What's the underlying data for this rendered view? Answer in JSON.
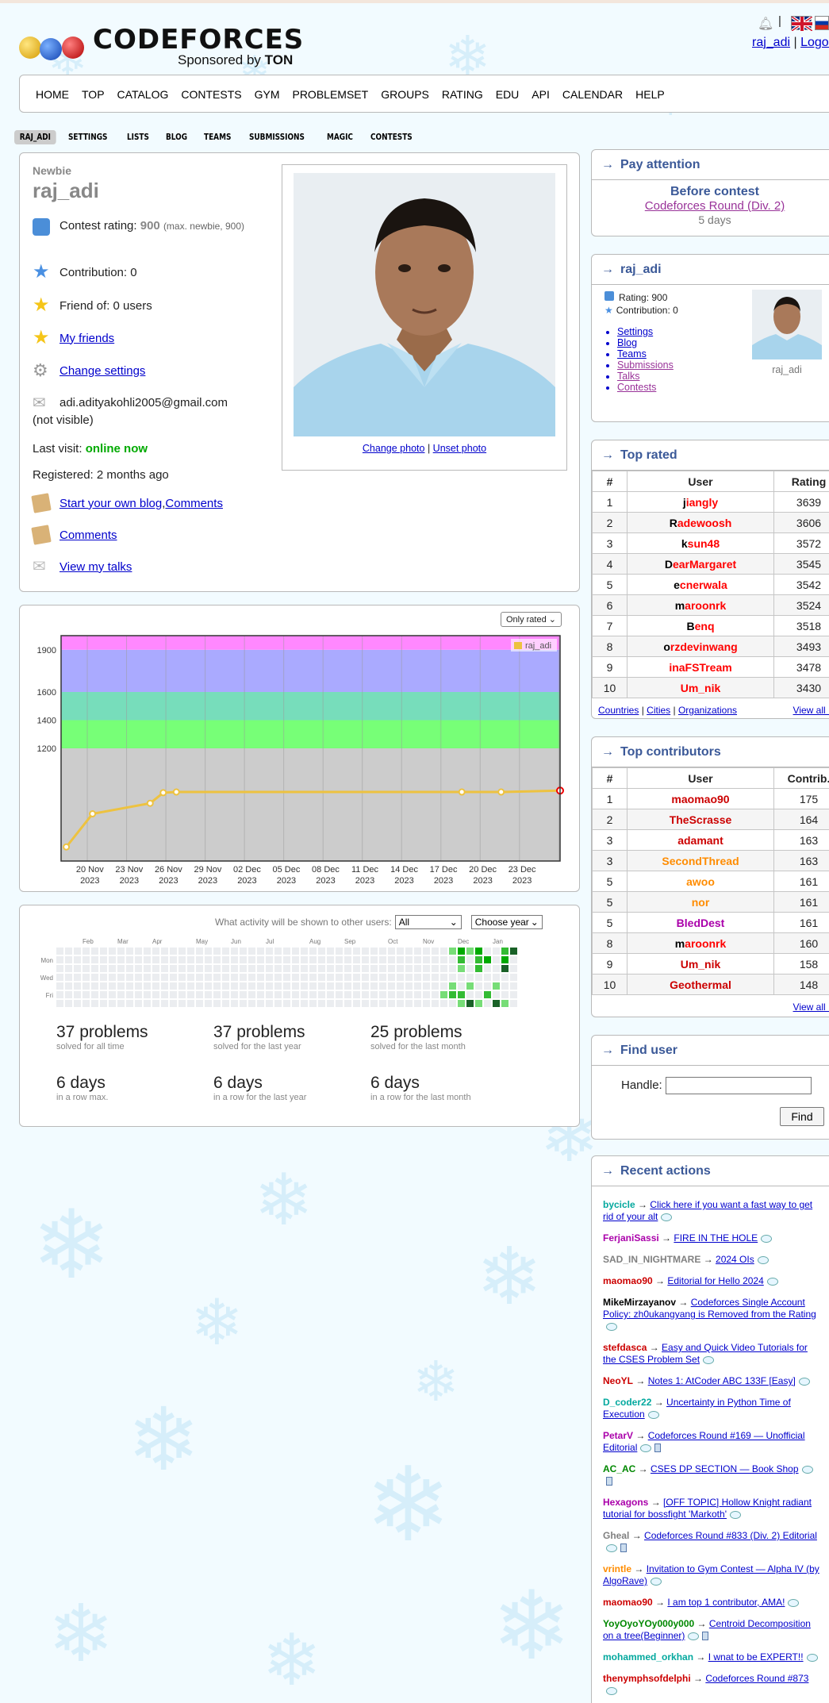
{
  "header": {
    "logo_text": "CODEFORCES",
    "sponsor_prefix": "Sponsored by",
    "sponsor_name": "TON",
    "user_link": "raj_adi",
    "separator": "|",
    "logout": "Logout"
  },
  "main_menu": [
    "HOME",
    "TOP",
    "CATALOG",
    "CONTESTS",
    "GYM",
    "PROBLEMSET",
    "GROUPS",
    "RATING",
    "EDU",
    "API",
    "CALENDAR",
    "HELP"
  ],
  "sub_menu": [
    "RAJ_ADI",
    "SETTINGS",
    "LISTS",
    "BLOG",
    "TEAMS",
    "SUBMISSIONS",
    "MAGIC",
    "CONTESTS"
  ],
  "profile": {
    "rank": "Newbie",
    "handle": "raj_adi",
    "rating_label": "Contest rating:",
    "rating": "900",
    "rating_max": "(max. newbie, 900)",
    "contribution": "Contribution: 0",
    "friend_of": "Friend of: 0 users",
    "my_friends": "My friends",
    "change_settings": "Change settings",
    "email": "adi.adityakohli2005@gmail.com",
    "email_note": "(not visible)",
    "last_visit_label": "Last visit:",
    "last_visit": "online now",
    "registered": "Registered: 2 months ago",
    "blog_link": "Start your own blog",
    "comments_inline": "Comments",
    "comments": "Comments",
    "talks": "View my talks",
    "change_photo": "Change photo",
    "unset_photo": "Unset photo",
    "photo_sep": "|"
  },
  "chart_data": {
    "type": "line",
    "filter": "Only rated",
    "legend": "raj_adi",
    "ytick_labels": [
      "1900",
      "1600",
      "1400",
      "1200"
    ],
    "xtick_labels": [
      "20 Nov\n2023",
      "23 Nov\n2023",
      "26 Nov\n2023",
      "29 Nov\n2023",
      "02 Dec\n2023",
      "05 Dec\n2023",
      "08 Dec\n2023",
      "11 Dec\n2023",
      "14 Dec\n2023",
      "17 Dec\n2023",
      "20 Dec\n2023",
      "23 Dec\n2023"
    ],
    "x_days": [
      0,
      1,
      2,
      3,
      4,
      5,
      6,
      7,
      8,
      9,
      10,
      11
    ],
    "x_start_label": "20 Nov 2023",
    "ylim": [
      400,
      2000
    ],
    "bands": [
      {
        "from": 400,
        "to": 1200,
        "color": "#cccccc"
      },
      {
        "from": 1200,
        "to": 1400,
        "color": "#77ff77"
      },
      {
        "from": 1400,
        "to": 1600,
        "color": "#77ddbb"
      },
      {
        "from": 1600,
        "to": 1900,
        "color": "#aaaaff"
      },
      {
        "from": 1900,
        "to": 2000,
        "color": "#ff88ff"
      }
    ],
    "points": [
      {
        "day": -1.2,
        "y": 500
      },
      {
        "day": 0.8,
        "y": 735
      },
      {
        "day": 5.2,
        "y": 810
      },
      {
        "day": 6.2,
        "y": 885
      },
      {
        "day": 7.2,
        "y": 890
      },
      {
        "day": 29.0,
        "y": 890
      },
      {
        "day": 32.0,
        "y": 890
      },
      {
        "day": 36.5,
        "y": 900
      }
    ],
    "line_color": "#edc240"
  },
  "activity": {
    "visibility_label": "What activity will be shown to other users:",
    "visibility_value": "All",
    "year_value": "Choose year",
    "months": [
      "Feb",
      "Mar",
      "Apr",
      "May",
      "Jun",
      "Jul",
      "Aug",
      "Sep",
      "Oct",
      "Nov",
      "Dec",
      "Jan"
    ],
    "days": [
      "Mon",
      "Wed",
      "Fri"
    ],
    "stats": [
      {
        "big": "37 problems",
        "small": "solved for all time"
      },
      {
        "big": "37 problems",
        "small": "solved for the last year"
      },
      {
        "big": "25 problems",
        "small": "solved for the last month"
      },
      {
        "big": "6 days",
        "small": "in a row max."
      },
      {
        "big": "6 days",
        "small": "in a row for the last year"
      },
      {
        "big": "6 days",
        "small": "in a row for the last month"
      }
    ]
  },
  "pay_attention": {
    "title": "Pay attention",
    "before": "Before contest",
    "contest": "Codeforces Round (Div. 2)",
    "when": "5 days"
  },
  "user_side": {
    "title": "raj_adi",
    "rating": "Rating: 900",
    "contribution": "Contribution: 0",
    "links": [
      "Settings",
      "Blog",
      "Teams",
      "Submissions",
      "Talks",
      "Contests"
    ],
    "photo_caption": "raj_adi"
  },
  "top_rated": {
    "title": "Top rated",
    "headers": [
      "#",
      "User",
      "Rating"
    ],
    "rows": [
      {
        "n": "1",
        "first": "j",
        "rest": "iangly",
        "v": "3639"
      },
      {
        "n": "2",
        "first": "R",
        "rest": "adewoosh",
        "v": "3606"
      },
      {
        "n": "3",
        "first": "k",
        "rest": "sun48",
        "v": "3572"
      },
      {
        "n": "4",
        "first": "D",
        "rest": "earMargaret",
        "v": "3545"
      },
      {
        "n": "5",
        "first": "e",
        "rest": "cnerwala",
        "v": "3542"
      },
      {
        "n": "6",
        "first": "m",
        "rest": "aroonrk",
        "v": "3524"
      },
      {
        "n": "7",
        "first": "B",
        "rest": "enq",
        "v": "3518"
      },
      {
        "n": "8",
        "first": "o",
        "rest": "rzdevinwang",
        "v": "3493"
      },
      {
        "n": "9",
        "first": "",
        "rest": "inaFSTream",
        "v": "3478"
      },
      {
        "n": "10",
        "first": "",
        "rest": "Um_nik",
        "v": "3430"
      }
    ],
    "footer": [
      "Countries",
      "Cities",
      "Organizations"
    ],
    "view_all": "View all →"
  },
  "top_contrib": {
    "title": "Top contributors",
    "headers": [
      "#",
      "User",
      "Contrib."
    ],
    "rows": [
      {
        "n": "1",
        "u": "maomao90",
        "c": "175",
        "cls": "ra"
      },
      {
        "n": "2",
        "u": "TheScrasse",
        "c": "164",
        "cls": "ra"
      },
      {
        "n": "3",
        "u": "adamant",
        "c": "163",
        "cls": "ra"
      },
      {
        "n": "3",
        "u": "SecondThread",
        "c": "163",
        "cls": "orange"
      },
      {
        "n": "5",
        "u": "awoo",
        "c": "161",
        "cls": "orange"
      },
      {
        "n": "5",
        "u": "nor",
        "c": "161",
        "cls": "orange"
      },
      {
        "n": "5",
        "u": "BledDest",
        "c": "161",
        "cls": "violet"
      },
      {
        "n": "8",
        "u": "maroonrk",
        "c": "160",
        "cls": "leg2"
      },
      {
        "n": "9",
        "u": "Um_nik",
        "c": "158",
        "cls": "ra"
      },
      {
        "n": "10",
        "u": "Geothermal",
        "c": "148",
        "cls": "ra"
      }
    ],
    "view_all": "View all →"
  },
  "find_user": {
    "title": "Find user",
    "label": "Handle:",
    "button": "Find"
  },
  "recent": {
    "title": "Recent actions",
    "items": [
      {
        "user": "bycicle",
        "cls": "cyan",
        "post": "Click here if you want a fast way to get rid of your alt"
      },
      {
        "user": "FerjaniSassi",
        "cls": "violet",
        "post": "FIRE IN THE HOLE"
      },
      {
        "user": "SAD_IN_NIGHTMARE",
        "cls": "gray",
        "post": "2024 OIs"
      },
      {
        "user": "maomao90",
        "cls": "ra",
        "post": "Editorial for Hello 2024"
      },
      {
        "user": "MikeMirzayanov",
        "cls": "leg2",
        "post": "Codeforces Single Account Policy: zh0ukangyang is Removed from the Rating"
      },
      {
        "user": "stefdasca",
        "cls": "ra",
        "post": "Easy and Quick Video Tutorials for the CSES Problem Set"
      },
      {
        "user": "NeoYL",
        "cls": "ra",
        "post": "Notes 1: AtCoder ABC 133F [Easy]"
      },
      {
        "user": "D_coder22",
        "cls": "cyan",
        "post": "Uncertainty in Python Time of Execution"
      },
      {
        "user": "PetarV",
        "cls": "violet",
        "post": "Codeforces Round #169 — Unofficial Editorial"
      },
      {
        "user": "AC_AC",
        "cls": "green",
        "post": "CSES DP SECTION — Book Shop"
      },
      {
        "user": "Hexagons",
        "cls": "violet",
        "post": "[OFF TOPIC] Hollow Knight radiant tutorial for bossfight 'Markoth'"
      },
      {
        "user": "Gheal",
        "cls": "gray",
        "post": "Codeforces Round #833 (Div. 2) Editorial"
      },
      {
        "user": "vrintle",
        "cls": "orange",
        "post": "Invitation to Gym Contest — Alpha IV (by AlgoRave)"
      },
      {
        "user": "maomao90",
        "cls": "ra",
        "post": "I am top 1 contributor, AMA!"
      },
      {
        "user": "YoyOyoYOy000y000",
        "cls": "green",
        "post": "Centroid Decomposition on a tree(Beginner)"
      },
      {
        "user": "mohammed_orkhan",
        "cls": "cyan",
        "post": "I wnat to be EXPERT!!"
      },
      {
        "user": "thenymphsofdelphi",
        "cls": "ra",
        "post": "Codeforces Round #873"
      }
    ],
    "arrow": "→"
  },
  "colors": {
    "accent": "#3b5998",
    "link": "#0000cc",
    "red": "#ff0000"
  }
}
